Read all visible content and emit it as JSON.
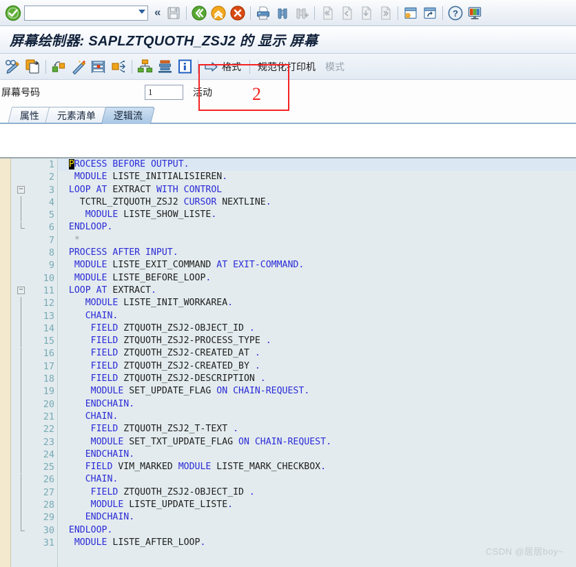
{
  "system_toolbar": {
    "ok_icon": "green-check-icon",
    "command_field": {
      "value": "",
      "placeholder": ""
    },
    "dropdown_icon": "chevron-down-icon",
    "collapse_icon": "double-chevron-left-icon",
    "buttons": [
      {
        "name": "save-button",
        "icon": "floppy-disk-icon",
        "enabled": false
      },
      {
        "name": "back-button",
        "icon": "green-back-arrow-icon",
        "enabled": true
      },
      {
        "name": "exit-button",
        "icon": "yellow-up-arrow-icon",
        "enabled": true
      },
      {
        "name": "cancel-button",
        "icon": "red-cancel-icon",
        "enabled": true
      },
      {
        "name": "print-button",
        "icon": "printer-icon",
        "enabled": true
      },
      {
        "name": "find-button",
        "icon": "binoculars-icon",
        "enabled": true
      },
      {
        "name": "find-next-button",
        "icon": "binoculars-plus-icon",
        "enabled": false
      },
      {
        "name": "first-page-button",
        "icon": "first-page-icon",
        "enabled": false
      },
      {
        "name": "previous-page-button",
        "icon": "previous-page-icon",
        "enabled": false
      },
      {
        "name": "next-page-button",
        "icon": "next-page-icon",
        "enabled": false
      },
      {
        "name": "last-page-button",
        "icon": "last-page-icon",
        "enabled": false
      },
      {
        "name": "create-session-button",
        "icon": "new-session-icon",
        "enabled": true
      },
      {
        "name": "create-shortcut-button",
        "icon": "shortcut-icon",
        "enabled": true
      },
      {
        "name": "help-button",
        "icon": "question-mark-icon",
        "enabled": true
      },
      {
        "name": "layout-menu-button",
        "icon": "customize-local-layout-icon",
        "enabled": true
      }
    ]
  },
  "title": {
    "prefix": "屏幕绘制器: ",
    "program": "SAPLZTQUOTH_ZSJ2",
    "suffix": " 的 显示 屏幕"
  },
  "app_toolbar": {
    "icon_buttons": [
      {
        "name": "display-change-button",
        "icon": "glasses-pencil-icon"
      },
      {
        "name": "copy-button",
        "icon": "copy-paste-icon"
      },
      {
        "name": "element-list-button",
        "icon": "element-link-icon"
      },
      {
        "name": "wizard-button",
        "icon": "magic-wand-icon"
      },
      {
        "name": "table-control-button",
        "icon": "table-control-icon"
      },
      {
        "name": "move-element-button",
        "icon": "move-arrows-icon"
      },
      {
        "name": "hierarchy-button",
        "icon": "hierarchy-icon"
      },
      {
        "name": "align-button",
        "icon": "align-stack-icon"
      },
      {
        "name": "info-button",
        "icon": "info-blue-icon"
      }
    ],
    "format_button": {
      "label": "格式",
      "icon": "right-arrow-icon"
    },
    "printer_label": "规范化打印机",
    "mode_label": "模式"
  },
  "screen_number": {
    "label": "屏幕号码",
    "value": "1",
    "status": "活动"
  },
  "tabs": [
    {
      "label": "属性",
      "name": "tab-attributes",
      "active": false
    },
    {
      "label": "元素清单",
      "name": "tab-element-list",
      "active": false
    },
    {
      "label": "逻辑流",
      "name": "tab-flow-logic",
      "active": true
    }
  ],
  "annotation": {
    "number": "2"
  },
  "watermark": "CSDN @居居boy~",
  "editor": {
    "cursor_char": "P",
    "lines": [
      {
        "n": 1,
        "fold": "open",
        "segments": [
          {
            "t": "  ",
            "c": "id"
          },
          {
            "t": "P",
            "c": "cur"
          },
          {
            "t": "ROCESS BEFORE OUTPUT",
            "c": "kw"
          },
          {
            "t": ".",
            "c": "kw"
          }
        ]
      },
      {
        "n": 2,
        "fold": "",
        "segments": [
          {
            "t": "   ",
            "c": "id"
          },
          {
            "t": "MODULE ",
            "c": "kw"
          },
          {
            "t": "LISTE_INITIALISIEREN",
            "c": "id"
          },
          {
            "t": ".",
            "c": "kw"
          }
        ]
      },
      {
        "n": 3,
        "fold": "minus",
        "segments": [
          {
            "t": "  ",
            "c": "id"
          },
          {
            "t": "LOOP AT ",
            "c": "kw"
          },
          {
            "t": "EXTRACT ",
            "c": "id"
          },
          {
            "t": "WITH CONTROL",
            "c": "kw"
          }
        ]
      },
      {
        "n": 4,
        "fold": "bar",
        "segments": [
          {
            "t": "    ",
            "c": "id"
          },
          {
            "t": "TCTRL_ZTQUOTH_ZSJ2 ",
            "c": "id"
          },
          {
            "t": "CURSOR ",
            "c": "kw"
          },
          {
            "t": "NEXTLINE",
            "c": "id"
          },
          {
            "t": ".",
            "c": "kw"
          }
        ]
      },
      {
        "n": 5,
        "fold": "bar",
        "segments": [
          {
            "t": "     ",
            "c": "id"
          },
          {
            "t": "MODULE ",
            "c": "kw"
          },
          {
            "t": "LISTE_SHOW_LISTE",
            "c": "id"
          },
          {
            "t": ".",
            "c": "kw"
          }
        ]
      },
      {
        "n": 6,
        "fold": "end",
        "segments": [
          {
            "t": "  ",
            "c": "id"
          },
          {
            "t": "ENDLOOP",
            "c": "kw"
          },
          {
            "t": ".",
            "c": "kw"
          }
        ]
      },
      {
        "n": 7,
        "fold": "",
        "segments": [
          {
            "t": "   ",
            "c": "id"
          },
          {
            "t": "*",
            "c": "cmt"
          }
        ]
      },
      {
        "n": 8,
        "fold": "",
        "segments": [
          {
            "t": "  ",
            "c": "id"
          },
          {
            "t": "PROCESS AFTER INPUT",
            "c": "kw"
          },
          {
            "t": ".",
            "c": "kw"
          }
        ]
      },
      {
        "n": 9,
        "fold": "",
        "segments": [
          {
            "t": "   ",
            "c": "id"
          },
          {
            "t": "MODULE ",
            "c": "kw"
          },
          {
            "t": "LISTE_EXIT_COMMAND ",
            "c": "id"
          },
          {
            "t": "AT EXIT-COMMAND",
            "c": "kw"
          },
          {
            "t": ".",
            "c": "kw"
          }
        ]
      },
      {
        "n": 10,
        "fold": "",
        "segments": [
          {
            "t": "   ",
            "c": "id"
          },
          {
            "t": "MODULE ",
            "c": "kw"
          },
          {
            "t": "LISTE_BEFORE_LOOP",
            "c": "id"
          },
          {
            "t": ".",
            "c": "kw"
          }
        ]
      },
      {
        "n": 11,
        "fold": "minus",
        "segments": [
          {
            "t": "  ",
            "c": "id"
          },
          {
            "t": "LOOP AT ",
            "c": "kw"
          },
          {
            "t": "EXTRACT",
            "c": "id"
          },
          {
            "t": ".",
            "c": "kw"
          }
        ]
      },
      {
        "n": 12,
        "fold": "bar",
        "segments": [
          {
            "t": "     ",
            "c": "id"
          },
          {
            "t": "MODULE ",
            "c": "kw"
          },
          {
            "t": "LISTE_INIT_WORKAREA",
            "c": "id"
          },
          {
            "t": ".",
            "c": "kw"
          }
        ]
      },
      {
        "n": 13,
        "fold": "bar",
        "segments": [
          {
            "t": "     ",
            "c": "id"
          },
          {
            "t": "CHAIN",
            "c": "kw"
          },
          {
            "t": ".",
            "c": "kw"
          }
        ]
      },
      {
        "n": 14,
        "fold": "bar",
        "segments": [
          {
            "t": "      ",
            "c": "id"
          },
          {
            "t": "FIELD ",
            "c": "kw"
          },
          {
            "t": "ZTQUOTH_ZSJ2-OBJECT_ID ",
            "c": "id"
          },
          {
            "t": ".",
            "c": "kw"
          }
        ]
      },
      {
        "n": 15,
        "fold": "bar",
        "segments": [
          {
            "t": "      ",
            "c": "id"
          },
          {
            "t": "FIELD ",
            "c": "kw"
          },
          {
            "t": "ZTQUOTH_ZSJ2-PROCESS_TYPE ",
            "c": "id"
          },
          {
            "t": ".",
            "c": "kw"
          }
        ]
      },
      {
        "n": 16,
        "fold": "bar",
        "segments": [
          {
            "t": "      ",
            "c": "id"
          },
          {
            "t": "FIELD ",
            "c": "kw"
          },
          {
            "t": "ZTQUOTH_ZSJ2-CREATED_AT ",
            "c": "id"
          },
          {
            "t": ".",
            "c": "kw"
          }
        ]
      },
      {
        "n": 17,
        "fold": "bar",
        "segments": [
          {
            "t": "      ",
            "c": "id"
          },
          {
            "t": "FIELD ",
            "c": "kw"
          },
          {
            "t": "ZTQUOTH_ZSJ2-CREATED_BY ",
            "c": "id"
          },
          {
            "t": ".",
            "c": "kw"
          }
        ]
      },
      {
        "n": 18,
        "fold": "bar",
        "segments": [
          {
            "t": "      ",
            "c": "id"
          },
          {
            "t": "FIELD ",
            "c": "kw"
          },
          {
            "t": "ZTQUOTH_ZSJ2-DESCRIPTION ",
            "c": "id"
          },
          {
            "t": ".",
            "c": "kw"
          }
        ]
      },
      {
        "n": 19,
        "fold": "bar",
        "segments": [
          {
            "t": "      ",
            "c": "id"
          },
          {
            "t": "MODULE ",
            "c": "kw"
          },
          {
            "t": "SET_UPDATE_FLAG ",
            "c": "id"
          },
          {
            "t": "ON CHAIN-REQUEST",
            "c": "kw"
          },
          {
            "t": ".",
            "c": "kw"
          }
        ]
      },
      {
        "n": 20,
        "fold": "bar",
        "segments": [
          {
            "t": "     ",
            "c": "id"
          },
          {
            "t": "ENDCHAIN",
            "c": "kw"
          },
          {
            "t": ".",
            "c": "kw"
          }
        ]
      },
      {
        "n": 21,
        "fold": "bar",
        "segments": [
          {
            "t": "     ",
            "c": "id"
          },
          {
            "t": "CHAIN",
            "c": "kw"
          },
          {
            "t": ".",
            "c": "kw"
          }
        ]
      },
      {
        "n": 22,
        "fold": "bar",
        "segments": [
          {
            "t": "      ",
            "c": "id"
          },
          {
            "t": "FIELD ",
            "c": "kw"
          },
          {
            "t": "ZTQUOTH_ZSJ2_T-TEXT ",
            "c": "id"
          },
          {
            "t": ".",
            "c": "kw"
          }
        ]
      },
      {
        "n": 23,
        "fold": "bar",
        "segments": [
          {
            "t": "      ",
            "c": "id"
          },
          {
            "t": "MODULE ",
            "c": "kw"
          },
          {
            "t": "SET_TXT_UPDATE_FLAG ",
            "c": "id"
          },
          {
            "t": "ON CHAIN-REQUEST",
            "c": "kw"
          },
          {
            "t": ".",
            "c": "kw"
          }
        ]
      },
      {
        "n": 24,
        "fold": "bar",
        "segments": [
          {
            "t": "     ",
            "c": "id"
          },
          {
            "t": "ENDCHAIN",
            "c": "kw"
          },
          {
            "t": ".",
            "c": "kw"
          }
        ]
      },
      {
        "n": 25,
        "fold": "bar",
        "segments": [
          {
            "t": "     ",
            "c": "id"
          },
          {
            "t": "FIELD ",
            "c": "kw"
          },
          {
            "t": "VIM_MARKED ",
            "c": "id"
          },
          {
            "t": "MODULE ",
            "c": "kw"
          },
          {
            "t": "LISTE_MARK_CHECKBOX",
            "c": "id"
          },
          {
            "t": ".",
            "c": "kw"
          }
        ]
      },
      {
        "n": 26,
        "fold": "bar",
        "segments": [
          {
            "t": "     ",
            "c": "id"
          },
          {
            "t": "CHAIN",
            "c": "kw"
          },
          {
            "t": ".",
            "c": "kw"
          }
        ]
      },
      {
        "n": 27,
        "fold": "bar",
        "segments": [
          {
            "t": "      ",
            "c": "id"
          },
          {
            "t": "FIELD ",
            "c": "kw"
          },
          {
            "t": "ZTQUOTH_ZSJ2-OBJECT_ID ",
            "c": "id"
          },
          {
            "t": ".",
            "c": "kw"
          }
        ]
      },
      {
        "n": 28,
        "fold": "bar",
        "segments": [
          {
            "t": "      ",
            "c": "id"
          },
          {
            "t": "MODULE ",
            "c": "kw"
          },
          {
            "t": "LISTE_UPDATE_LISTE",
            "c": "id"
          },
          {
            "t": ".",
            "c": "kw"
          }
        ]
      },
      {
        "n": 29,
        "fold": "bar",
        "segments": [
          {
            "t": "     ",
            "c": "id"
          },
          {
            "t": "ENDCHAIN",
            "c": "kw"
          },
          {
            "t": ".",
            "c": "kw"
          }
        ]
      },
      {
        "n": 30,
        "fold": "end",
        "segments": [
          {
            "t": "  ",
            "c": "id"
          },
          {
            "t": "ENDLOOP",
            "c": "kw"
          },
          {
            "t": ".",
            "c": "kw"
          }
        ]
      },
      {
        "n": 31,
        "fold": "",
        "segments": [
          {
            "t": "   ",
            "c": "id"
          },
          {
            "t": "MODULE ",
            "c": "kw"
          },
          {
            "t": "LISTE_AFTER_LOOP",
            "c": "id"
          },
          {
            "t": ".",
            "c": "kw"
          }
        ]
      }
    ]
  }
}
